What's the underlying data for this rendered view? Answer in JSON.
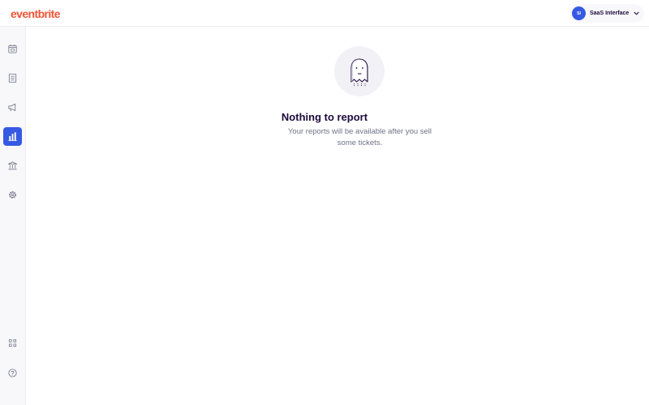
{
  "app": {
    "logo_text": "eventbrite"
  },
  "account": {
    "initials": "SI",
    "name": "SaaS Interface"
  },
  "sidebar": {
    "items": [
      {
        "name": "events",
        "icon": "calendar-icon",
        "active": false
      },
      {
        "name": "orders",
        "icon": "document-icon",
        "active": false
      },
      {
        "name": "marketing",
        "icon": "megaphone-icon",
        "active": false
      },
      {
        "name": "reporting",
        "icon": "bar-chart-icon",
        "active": true
      },
      {
        "name": "finance",
        "icon": "bank-icon",
        "active": false
      },
      {
        "name": "settings",
        "icon": "gear-icon",
        "active": false
      }
    ],
    "bottom_items": [
      {
        "name": "apps",
        "icon": "grid-icon"
      },
      {
        "name": "help",
        "icon": "help-icon"
      }
    ]
  },
  "empty_state": {
    "illustration": "ghost-icon",
    "title": "Nothing to report",
    "message": "Your reports will be available after you sell some tickets."
  },
  "colors": {
    "brand": "#f05537",
    "accent": "#3659e3",
    "text": "#1e0a3c",
    "muted": "#6f7287"
  }
}
